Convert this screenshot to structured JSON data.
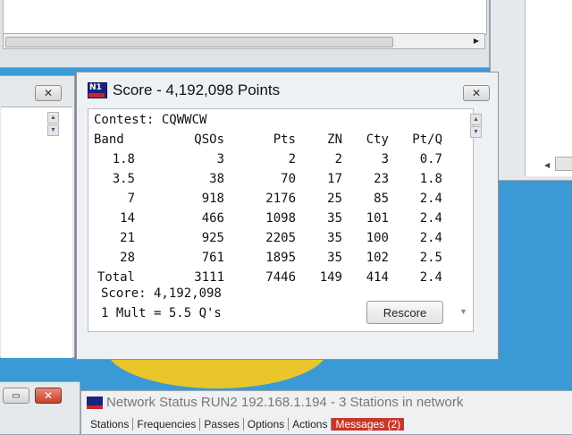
{
  "score_window": {
    "title": "Score - 4,192,098 Points",
    "contest_label": "Contest:",
    "contest_value": "CQWWCW",
    "columns": [
      "Band",
      "QSOs",
      "Pts",
      "ZN",
      "Cty",
      "Pt/Q"
    ],
    "rows": [
      [
        "1.8",
        "3",
        "2",
        "2",
        "3",
        "0.7"
      ],
      [
        "3.5",
        "38",
        "70",
        "17",
        "23",
        "1.8"
      ],
      [
        "7",
        "918",
        "2176",
        "25",
        "85",
        "2.4"
      ],
      [
        "14",
        "466",
        "1098",
        "35",
        "101",
        "2.4"
      ],
      [
        "21",
        "925",
        "2205",
        "35",
        "100",
        "2.4"
      ],
      [
        "28",
        "761",
        "1895",
        "35",
        "102",
        "2.5"
      ],
      [
        "Total",
        "3111",
        "7446",
        "149",
        "414",
        "2.4"
      ]
    ],
    "score_line": "Score: 4,192,098",
    "mult_line": "1 Mult = 5.5 Q's",
    "rescore_label": "Rescore",
    "close_label": "✕"
  },
  "network_window": {
    "title": "Network Status RUN2 192.168.1.194 - 3 Stations in network",
    "tabs": [
      {
        "label": "Stations"
      },
      {
        "label": "Frequencies"
      },
      {
        "label": "Passes"
      },
      {
        "label": "Options"
      },
      {
        "label": "Actions"
      },
      {
        "label": "Messages (2)"
      }
    ]
  },
  "other_windows": {
    "left_close_label": "✕",
    "bottom_close_label": "✕",
    "bottom_min_label": "▭"
  },
  "colors": {
    "desktop": "#3b9ad6",
    "close_red": "#c6402c",
    "messages_tab": "#c8372a"
  }
}
